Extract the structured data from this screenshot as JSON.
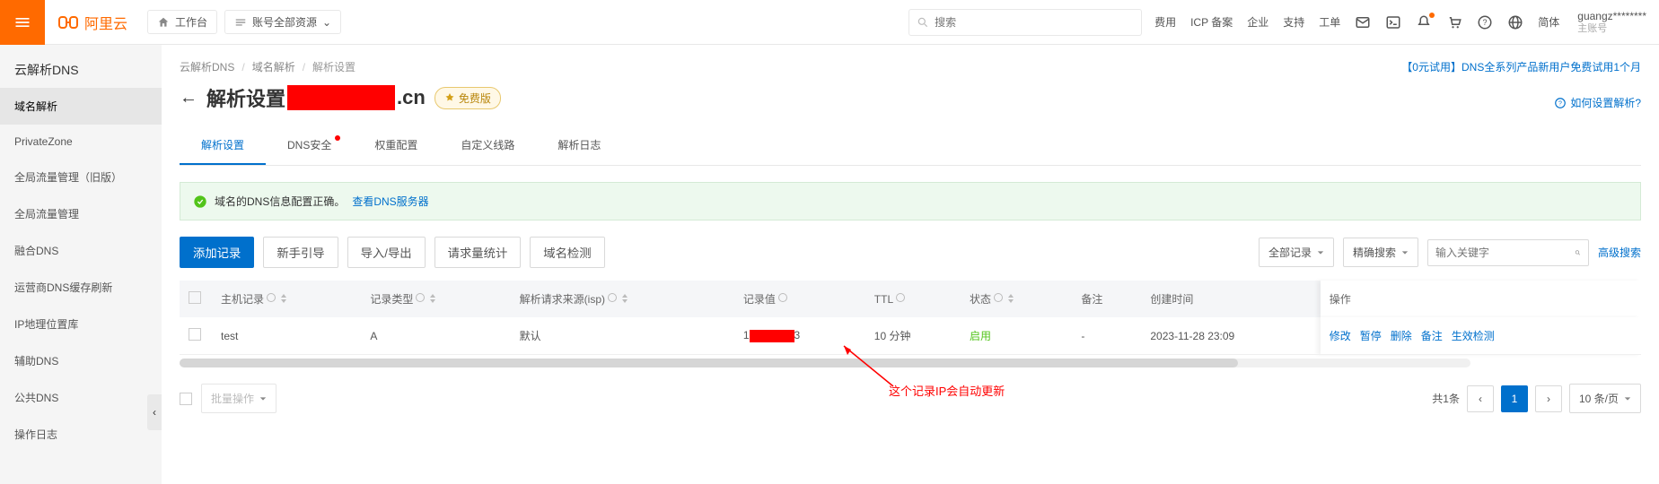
{
  "header": {
    "brand": "阿里云",
    "workbench": "工作台",
    "acct_all_res": "账号全部资源",
    "search_placeholder": "搜索",
    "right_links": [
      "费用",
      "ICP 备案",
      "企业",
      "支持",
      "工单"
    ],
    "lang": "简体",
    "user": "guangz********",
    "user_sub": "主账号"
  },
  "sidebar": {
    "title": "云解析DNS",
    "items": [
      "域名解析",
      "PrivateZone",
      "全局流量管理（旧版）",
      "全局流量管理",
      "融合DNS",
      "运营商DNS缓存刷新",
      "IP地理位置库",
      "辅助DNS",
      "公共DNS",
      "操作日志"
    ]
  },
  "breadcrumb": {
    "p0": "云解析DNS",
    "p1": "域名解析",
    "p2": "解析设置"
  },
  "promo": {
    "tag": "【0元试用】",
    "text": "DNS全系列产品新用户免费试用1个月"
  },
  "title": {
    "pre": "解析设置",
    "suf": ".cn",
    "badge": "免费版"
  },
  "help_link": "如何设置解析?",
  "tabs": [
    "解析设置",
    "DNS安全",
    "权重配置",
    "自定义线路",
    "解析日志"
  ],
  "ok_banner": {
    "text": "域名的DNS信息配置正确。",
    "link": "查看DNS服务器"
  },
  "actions": {
    "add": "添加记录",
    "guide": "新手引导",
    "io": "导入/导出",
    "reqstat": "请求量统计",
    "domchk": "域名检测"
  },
  "filters": {
    "scope": "全部记录",
    "mode": "精确搜索",
    "placeholder": "输入关键字",
    "adv": "高级搜索"
  },
  "cols": {
    "host": "主机记录",
    "type": "记录类型",
    "isp": "解析请求来源(isp)",
    "value": "记录值",
    "ttl": "TTL",
    "status": "状态",
    "remark": "备注",
    "ctime": "创建时间",
    "ops": "操作"
  },
  "row": {
    "host": "test",
    "type": "A",
    "isp": "默认",
    "val_pre": "1",
    "val_suf": "3",
    "ttl": "10 分钟",
    "status": "启用",
    "remark": "-",
    "ctime": "2023-11-28 23:09"
  },
  "row_actions": [
    "修改",
    "暂停",
    "删除",
    "备注",
    "生效检测"
  ],
  "bulk": "批量操作",
  "pager": {
    "total": "共1条",
    "one": "1",
    "size": "10 条/页"
  },
  "annotation": "这个记录IP会自动更新"
}
